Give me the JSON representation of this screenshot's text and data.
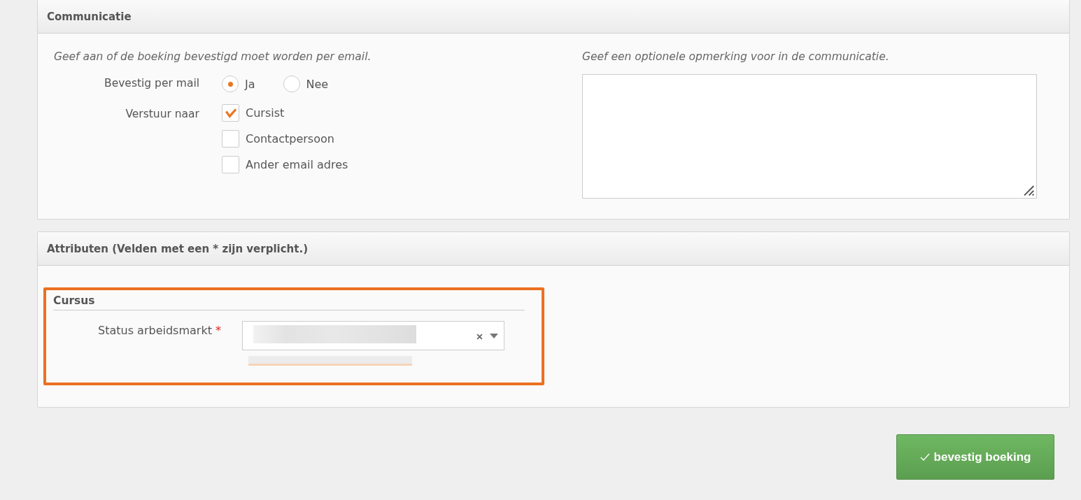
{
  "communicatie": {
    "title": "Communicatie",
    "left_hint": "Geef aan of de boeking bevestigd moet worden per email.",
    "right_hint": "Geef een optionele opmerking voor in de communicatie.",
    "confirm": {
      "label": "Bevestig per mail",
      "options": [
        {
          "label": "Ja",
          "selected": true
        },
        {
          "label": "Nee",
          "selected": false
        }
      ]
    },
    "send_to": {
      "label": "Verstuur naar",
      "options": [
        {
          "label": "Cursist",
          "checked": true
        },
        {
          "label": "Contactpersoon",
          "checked": false
        },
        {
          "label": "Ander email adres",
          "checked": false
        }
      ]
    }
  },
  "attributen": {
    "title": "Attributen (Velden met een * zijn verplicht.)",
    "group": {
      "title": "Cursus",
      "field": {
        "label": "Status arbeidsmarkt",
        "required_mark": "*"
      }
    }
  },
  "submit": {
    "label": "bevestig boeking"
  }
}
